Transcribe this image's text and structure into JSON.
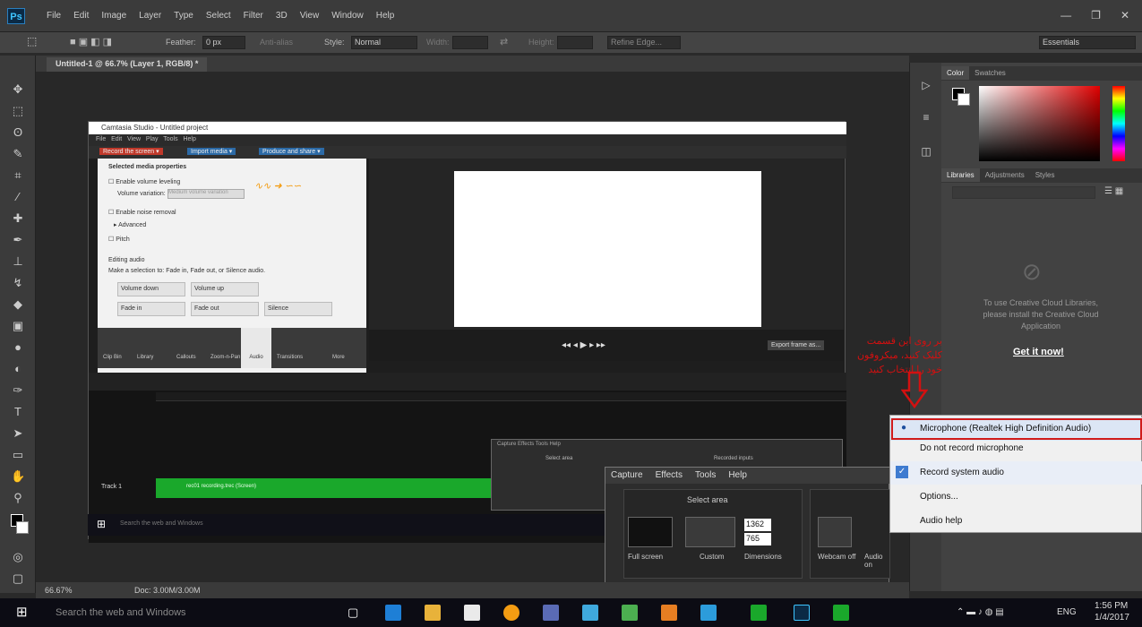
{
  "app": {
    "logo": "Ps",
    "menu": [
      "File",
      "Edit",
      "Image",
      "Layer",
      "Type",
      "Select",
      "Filter",
      "3D",
      "View",
      "Window",
      "Help"
    ],
    "window_controls": [
      "—",
      "❐",
      "✕"
    ]
  },
  "options": {
    "feather_label": "Feather:",
    "feather_value": "0 px",
    "anti_alias": "Anti-alias",
    "style_label": "Style:",
    "style_value": "Normal",
    "width_label": "Width:",
    "height_label": "Height:",
    "refine_edge": "Refine Edge...",
    "workspace": "Essentials"
  },
  "document": {
    "tab": "Untitled-1 @ 66.7% (Layer 1, RGB/8) *",
    "zoom": "66.67%",
    "doc_size": "Doc: 3.00M/3.00M"
  },
  "panels": {
    "color_tabs": [
      "Color",
      "Swatches"
    ],
    "lib_tabs": [
      "Libraries",
      "Adjustments",
      "Styles"
    ],
    "libraries_message": "To use Creative Cloud Libraries, please install the Creative Cloud Application",
    "get_it_now": "Get it now!"
  },
  "camtasia": {
    "title": "Camtasia Studio - Untitled project",
    "menu": [
      "File",
      "Edit",
      "View",
      "Play",
      "Tools",
      "Help"
    ],
    "toolbar": [
      "Record the screen ▾",
      "Import media ▾",
      "Produce and share ▾"
    ],
    "props": {
      "header": "Selected media properties",
      "volume_leveling": "Enable volume leveling",
      "volume_variation": "Volume variation:",
      "volume_variation_value": "Medium volume variation",
      "noise_removal": "Enable noise removal",
      "advanced": "Advanced",
      "pitch": "Pitch",
      "editing_label": "Editing audio",
      "editing_hint": "Make a selection to: Fade in, Fade out, or Silence audio.",
      "buttons": [
        "Volume down",
        "Volume up",
        "Fade in",
        "Fade out",
        "Silence"
      ]
    },
    "clip_tabs": [
      "Clip Bin",
      "Library",
      "Callouts",
      "Zoom-n-Pan",
      "Audio",
      "Transitions",
      "More"
    ],
    "export_button": "Export frame as...",
    "track_label": "Track 1",
    "track_clip": "rec01 recording.trec (Screen)"
  },
  "small_rec": {
    "menu": [
      "Capture",
      "Effects",
      "Tools",
      "Help"
    ],
    "select_area": "Select area",
    "recorded_inputs": "Recorded inputs"
  },
  "recorder": {
    "menu": [
      "Capture",
      "Effects",
      "Tools",
      "Help"
    ],
    "select_area": "Select area",
    "full_screen": "Full screen",
    "custom": "Custom",
    "dimensions": "Dimensions",
    "width": "1362",
    "height": "765",
    "webcam": "Webcam off",
    "audio": "Audio on"
  },
  "dropdown": {
    "items": [
      "Microphone (Realtek High Definition Audio)",
      "Do not record microphone",
      "Record system audio",
      "Options...",
      "Audio help"
    ]
  },
  "annotation": {
    "text": "بر روی این قسمت کلیک کنید، میکروفون خود را انتخاب کنید"
  },
  "taskbar": {
    "search": "Search the web and Windows",
    "lang": "ENG",
    "time": "1:56 PM",
    "date": "1/4/2017"
  },
  "colors": {
    "green_clip": "#1aa82b",
    "accent_red": "#d31010",
    "ps_blue": "#3ec5ff"
  }
}
